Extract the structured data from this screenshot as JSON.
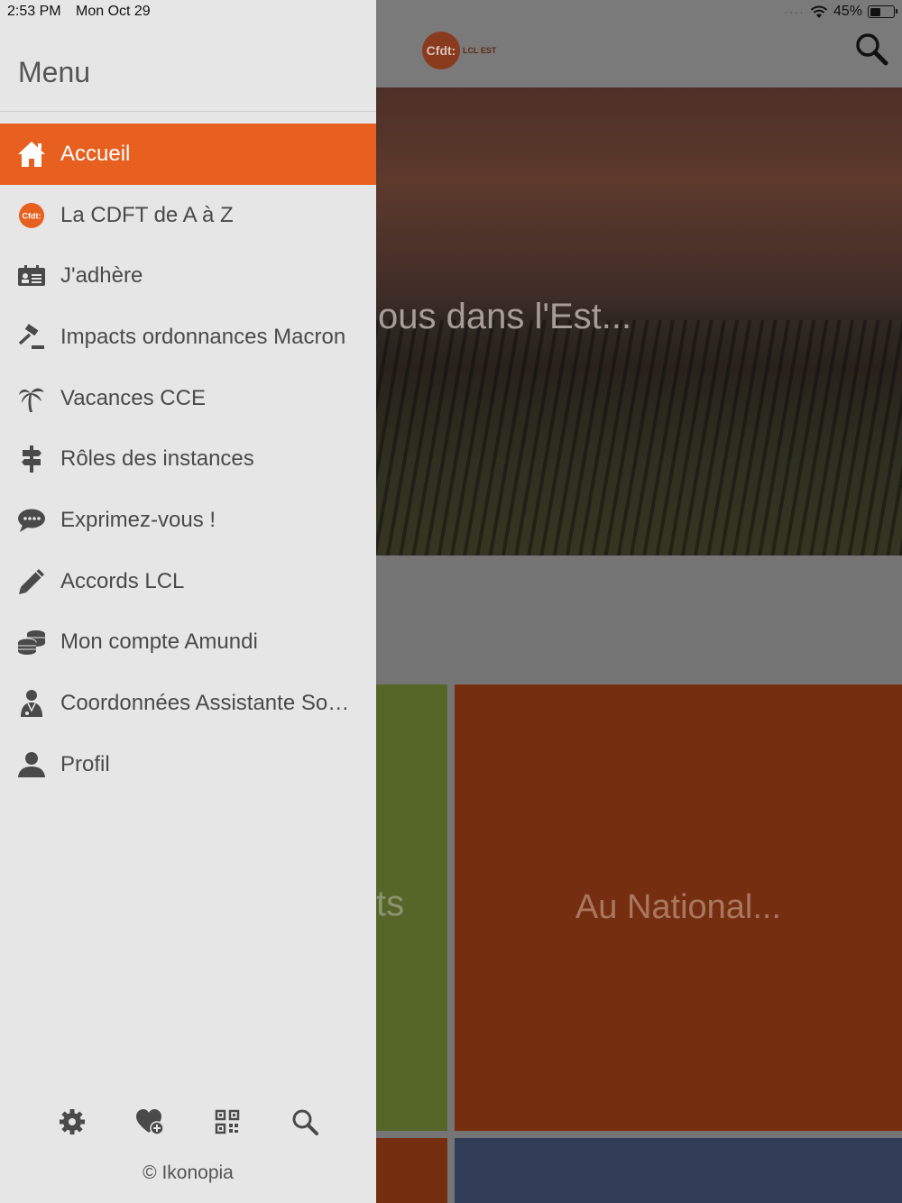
{
  "status_bar": {
    "time": "2:53 PM",
    "date": "Mon Oct 29",
    "battery": "45%",
    "battery_level": 0.45
  },
  "drawer": {
    "title": "Menu",
    "items": [
      {
        "label": "Accueil",
        "icon": "home-icon",
        "active": true
      },
      {
        "label": "La CDFT de A à Z",
        "icon": "cfdt-logo-icon"
      },
      {
        "label": "J'adhère",
        "icon": "id-card-icon"
      },
      {
        "label": "Impacts ordonnances Macron",
        "icon": "gavel-icon"
      },
      {
        "label": "Vacances CCE",
        "icon": "palm-tree-icon"
      },
      {
        "label": "Rôles des instances",
        "icon": "signpost-icon"
      },
      {
        "label": "Exprimez-vous !",
        "icon": "chat-bubble-icon"
      },
      {
        "label": "Accords LCL",
        "icon": "pencil-icon"
      },
      {
        "label": "Mon compte Amundi",
        "icon": "coins-icon"
      },
      {
        "label": "Coordonnées Assistante Sociale",
        "icon": "person-icon"
      },
      {
        "label": "Profil",
        "icon": "user-icon"
      }
    ],
    "bottom_icons": [
      "settings-icon",
      "favorite-add-icon",
      "qr-code-icon",
      "search-icon"
    ],
    "copyright": "© Ikonopia"
  },
  "app": {
    "logo_text": "Cfdt:",
    "logo_sub": "LCL EST",
    "hero_title": "ous dans l'Est...",
    "tile_green_text": "ts",
    "tile_orange_text": "Au National..."
  },
  "colors": {
    "accent": "#e8601f",
    "drawer_bg": "#e6e6e6"
  }
}
